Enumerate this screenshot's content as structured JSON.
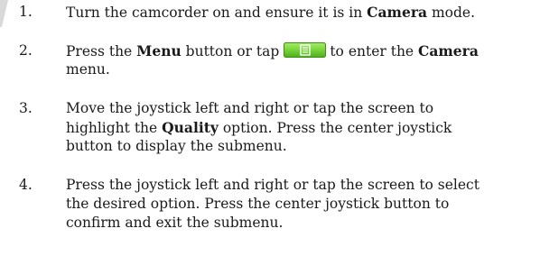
{
  "steps": [
    {
      "number": "1.",
      "lines": [
        [
          {
            "text": "Turn the camcorder on and ensure it is in ",
            "bold": false
          },
          {
            "text": "Camera",
            "bold": true
          },
          {
            "text": " mode.",
            "bold": false
          }
        ]
      ]
    },
    {
      "number": "2.",
      "lines": [
        [
          {
            "text": "Press the ",
            "bold": false
          },
          {
            "text": "Menu",
            "bold": true
          },
          {
            "text": " button or tap",
            "bold": false
          },
          {
            "icon": "menu-icon"
          },
          {
            "text": "to enter the ",
            "bold": false
          },
          {
            "text": "Camera",
            "bold": true
          }
        ],
        [
          {
            "text": "menu.",
            "bold": false
          }
        ]
      ]
    },
    {
      "number": "3.",
      "lines": [
        [
          {
            "text": "Move the joystick left and right or tap the screen to",
            "bold": false
          }
        ],
        [
          {
            "text": "highlight the ",
            "bold": false
          },
          {
            "text": "Quality",
            "bold": true
          },
          {
            "text": " option. Press the center joystick",
            "bold": false
          }
        ],
        [
          {
            "text": "button to display the submenu.",
            "bold": false
          }
        ]
      ]
    },
    {
      "number": "4.",
      "lines": [
        [
          {
            "text": "Press the joystick left and right or tap the screen to select",
            "bold": false
          }
        ],
        [
          {
            "text": "the desired option. Press the center joystick button to",
            "bold": false
          }
        ],
        [
          {
            "text": "confirm and exit the submenu.",
            "bold": false
          }
        ]
      ]
    }
  ],
  "colors": {
    "text": "#1a1a1a",
    "icon_fill": "#78d23a",
    "icon_border": "#3f8f12",
    "icon_glyph": "#ffffff",
    "corner_mark": "#d9d9d9"
  }
}
